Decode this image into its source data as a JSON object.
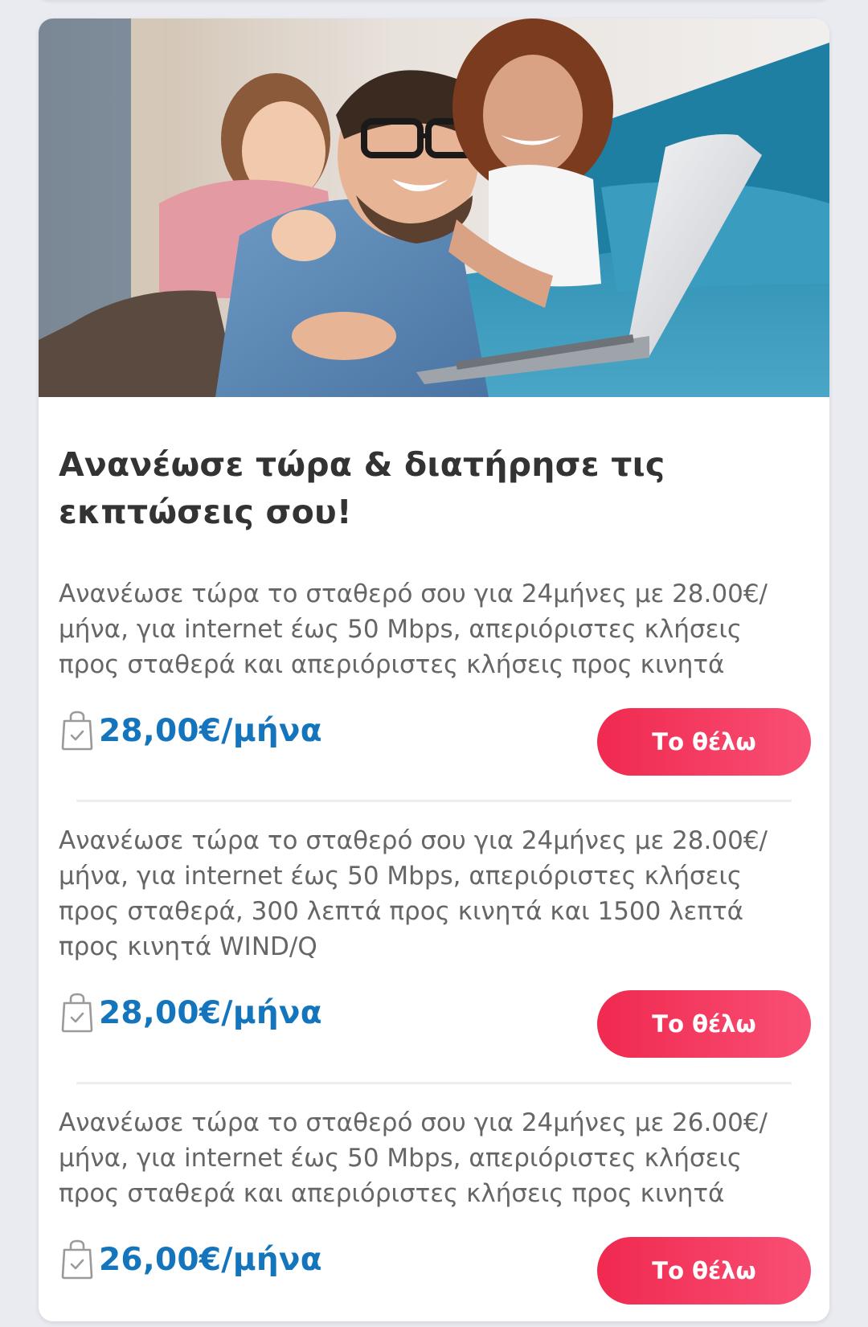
{
  "card": {
    "title": "Ανανέωσε τώρα & διατήρησε τις εκπτώσεις σου!",
    "hero_image": "family-laptop-photo"
  },
  "offers": [
    {
      "description": "Ανανέωσε τώρα το σταθερό σου για 24μήνες με 28.00€/μήνα, για internet έως 50 Mbps, απεριόριστες κλήσεις προς σταθερά και απεριόριστες κλήσεις προς κινητά",
      "price": "28,00€/μήνα",
      "cta": "Το θέλω"
    },
    {
      "description": "Ανανέωσε τώρα το σταθερό σου για 24μήνες με 28.00€/μήνα, για internet έως 50 Mbps, απεριόριστες κλήσεις προς σταθερά, 300 λεπτά προς κινητά και 1500 λεπτά προς κινητά WIND/Q",
      "price": "28,00€/μήνα",
      "cta": "Το θέλω"
    },
    {
      "description": "Ανανέωσε τώρα το σταθερό σου για 24μήνες με 26.00€/μήνα, για internet έως 50 Mbps, απεριόριστες κλήσεις προς σταθερά και απεριόριστες κλήσεις προς κινητά",
      "price": "26,00€/μήνα",
      "cta": "Το θέλω"
    }
  ],
  "colors": {
    "background": "#e9ebf0",
    "price": "#1475bd",
    "cta_start": "#f0294f",
    "cta_end": "#f94f74",
    "title": "#333333",
    "description": "#666666"
  },
  "icons": {
    "price_icon": "shopping-bag-check-icon"
  }
}
